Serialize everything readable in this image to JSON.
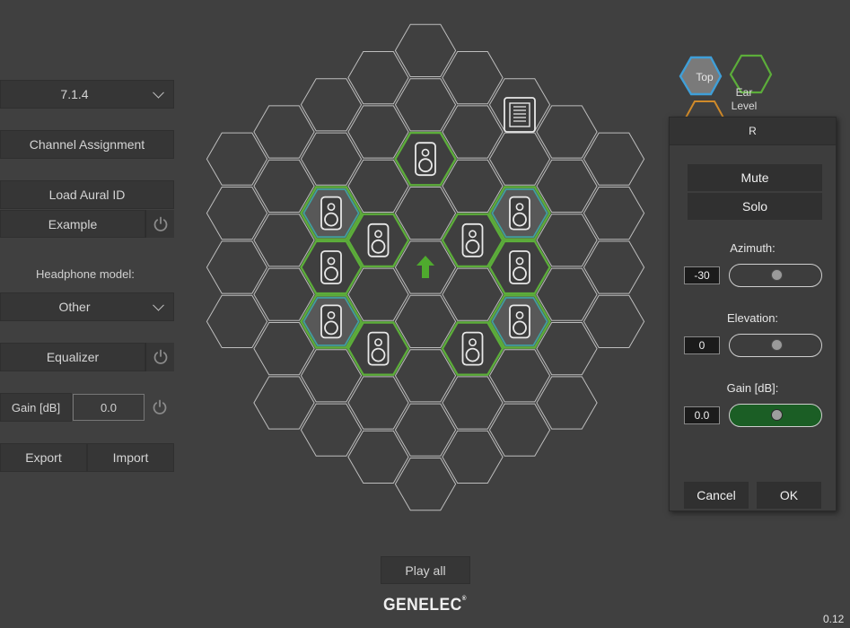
{
  "left_panel": {
    "layout_select": "7.1.4",
    "channel_assignment": "Channel Assignment",
    "load_aural_id": "Load Aural ID",
    "example": "Example",
    "headphone_label": "Headphone model:",
    "headphone_select": "Other",
    "equalizer": "Equalizer",
    "gain_label": "Gain [dB]",
    "gain_value": "0.0",
    "export": "Export",
    "import": "Import"
  },
  "layer_selector": {
    "top": "Top",
    "ear_level": "Ear Level"
  },
  "grid": {
    "speaker_count": 11
  },
  "play_all": "Play all",
  "brand": "GENELEC",
  "version": "0.12",
  "channel_dialog": {
    "title": "R",
    "mute": "Mute",
    "solo": "Solo",
    "azimuth_label": "Azimuth:",
    "azimuth_value": "-30",
    "elevation_label": "Elevation:",
    "elevation_value": "0",
    "gain_label": "Gain [dB]:",
    "gain_value": "0.0",
    "cancel": "Cancel",
    "ok": "OK"
  },
  "colors": {
    "accent_green": "#5cad3a",
    "accent_teal": "#3fa3a3",
    "top_blue": "#3f9fd8",
    "active_slider": "#1b5e25"
  }
}
